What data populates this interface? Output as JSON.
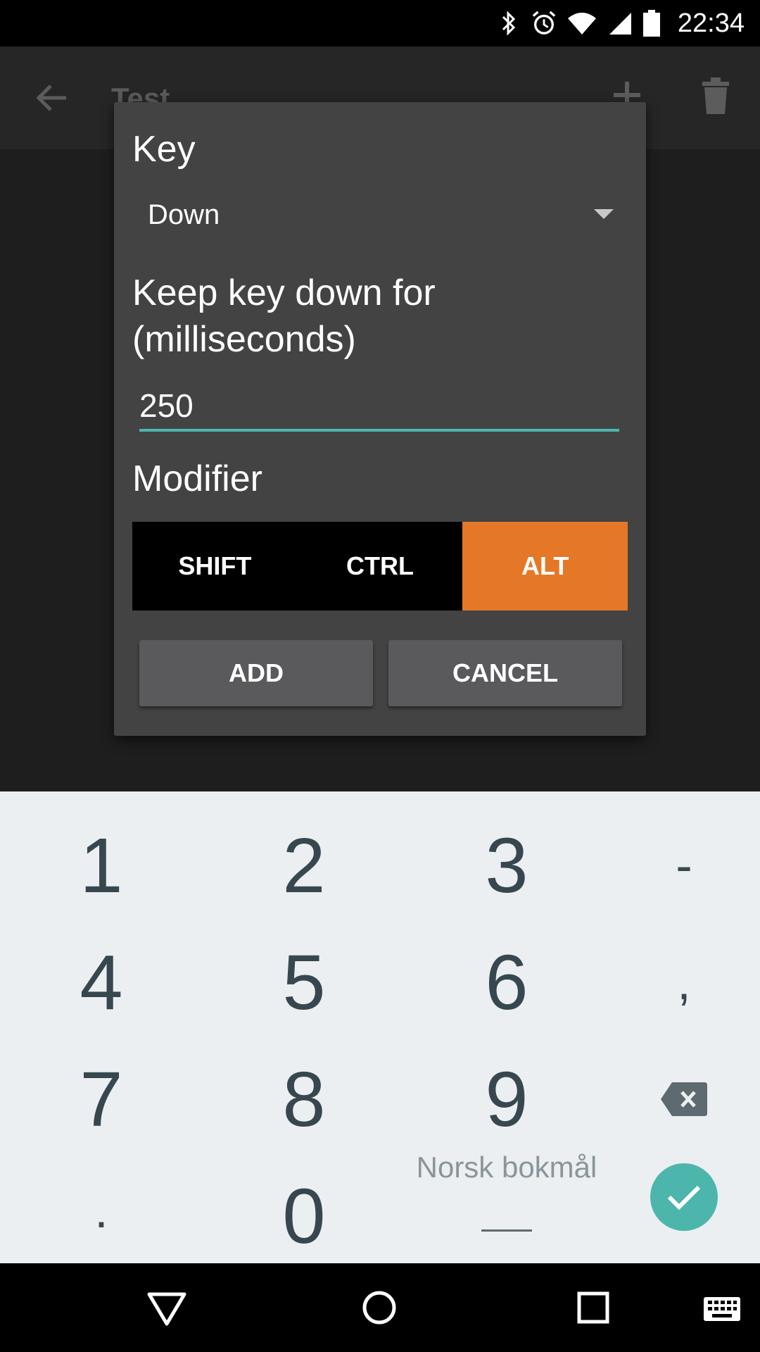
{
  "status_bar": {
    "time": "22:34",
    "icons": [
      "bluetooth-icon",
      "alarm-icon",
      "wifi-icon",
      "cell-signal-icon",
      "battery-icon"
    ]
  },
  "app_bar": {
    "title": "Test",
    "icons": [
      "back-arrow-icon",
      "add-icon",
      "delete-icon"
    ]
  },
  "dialog": {
    "key_label": "Key",
    "key_value": "Down",
    "keep_label_line1": "Keep key down for",
    "keep_label_line2": "(milliseconds)",
    "duration_value": "250",
    "modifier_label": "Modifier",
    "modifiers": [
      {
        "label": "SHIFT",
        "selected": false
      },
      {
        "label": "CTRL",
        "selected": false
      },
      {
        "label": "ALT",
        "selected": true
      }
    ],
    "add_label": "ADD",
    "cancel_label": "CANCEL"
  },
  "keyboard": {
    "rows": [
      [
        "1",
        "2",
        "3",
        "-"
      ],
      [
        "4",
        "5",
        "6",
        ","
      ],
      [
        "7",
        "8",
        "9",
        "backspace"
      ],
      [
        ".",
        "0",
        "Norsk bokmål",
        "enter"
      ]
    ],
    "language": "Norsk bokmål"
  },
  "colors": {
    "accent": "#4db6ac",
    "selected_modifier": "#e57826",
    "dialog_bg": "#434343"
  }
}
